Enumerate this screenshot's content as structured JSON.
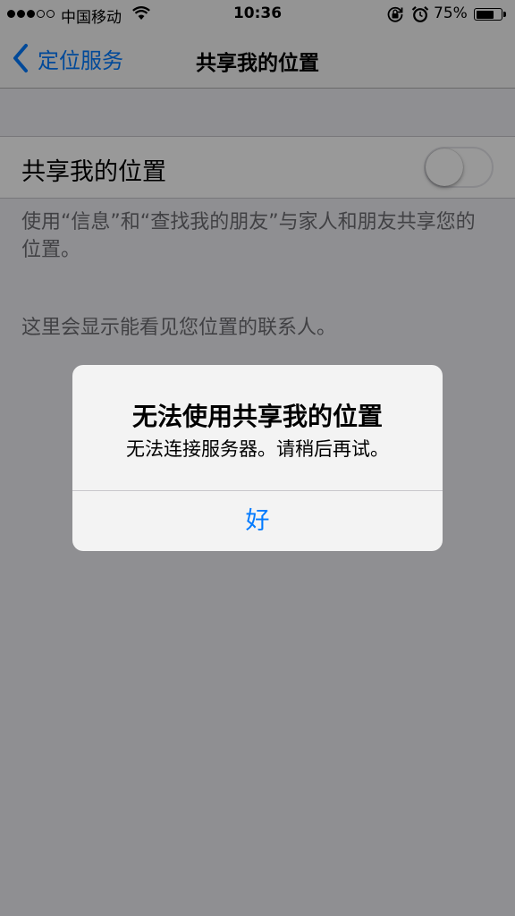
{
  "status_bar": {
    "carrier": "中国移动",
    "time": "10:36",
    "battery_percent": "75%",
    "battery_level": 0.75,
    "signal_strength": 3,
    "signal_max": 5
  },
  "nav_bar": {
    "back_label": "定位服务",
    "title": "共享我的位置"
  },
  "settings": {
    "row_label": "共享我的位置",
    "toggle_on": false,
    "description": "使用“信息”和“查找我的朋友”与家人和朋友共享您的位置。",
    "contacts_note": "这里会显示能看见您位置的联系人。"
  },
  "alert": {
    "title": "无法使用共享我的位置",
    "message": "无法连接服务器。请稍后再试。",
    "button_label": "好"
  },
  "colors": {
    "accent": "#007aff",
    "background": "#efeff4",
    "footer_text": "#6d6d72"
  },
  "icons": [
    "wifi-icon",
    "rotation-lock-icon",
    "alarm-icon",
    "battery-icon",
    "chevron-left-icon"
  ]
}
